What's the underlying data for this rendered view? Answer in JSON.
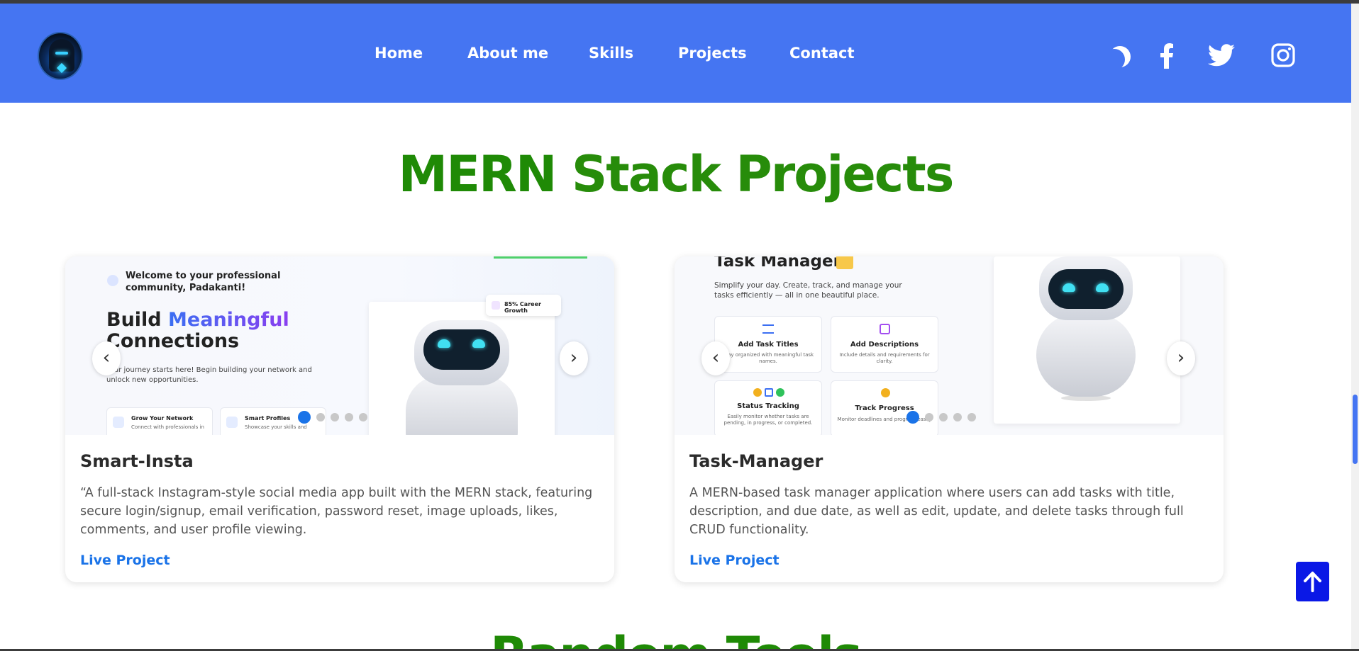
{
  "nav": {
    "links": [
      "Home",
      "About me",
      "Skills",
      "Projects",
      "Contact"
    ],
    "icons": [
      "moon-icon",
      "facebook-icon",
      "twitter-icon",
      "instagram-icon"
    ]
  },
  "section": {
    "title_word1": "MERN",
    "title_word2": "Stack Projects",
    "next_title": "Random Tools"
  },
  "projects": [
    {
      "title": "Smart-Insta",
      "description": "“A full-stack Instagram-style social media app built with the MERN stack, featuring secure login/signup, email verification, password reset, image uploads, likes, comments, and user profile viewing.",
      "link": "Live Project",
      "preview": {
        "welcome": "Welcome to your professional community, Padakanti!",
        "headline_1": "Build",
        "headline_2": "Meaningful",
        "headline_3": "Connections",
        "subtext": "Your journey starts here! Begin building your network and unlock new opportunities.",
        "badge": "85% Career Growth",
        "feature_1": "Grow Your Network",
        "feature_1_desc": "Connect with professionals in",
        "feature_2": "Smart Profiles",
        "feature_2_desc": "Showcase your skills and"
      },
      "slides": 5,
      "active_slide": 1
    },
    {
      "title": "Task-Manager",
      "description": "A MERN-based task manager application where users can add tasks with title, description, and due date, as well as edit, update, and delete tasks through full CRUD functionality.",
      "link": "Live Project",
      "preview": {
        "heading": "Task Manager",
        "subtext": "Simplify your day. Create, track, and manage your tasks efficiently — all in one beautiful place.",
        "feature_1": "Add Task Titles",
        "feature_1_desc": "Stay organized with meaningful task names.",
        "feature_2": "Add Descriptions",
        "feature_2_desc": "Include details and requirements for clarity.",
        "feature_3": "Status Tracking",
        "feature_3_desc": "Easily monitor whether tasks are pending, in progress, or completed.",
        "feature_4": "Track Progress",
        "feature_4_desc": "Monitor deadlines and progress easily"
      },
      "slides": 5,
      "active_slide": 1
    }
  ],
  "colors": {
    "navbar": "#4575f2",
    "title_green": "#1f8a06",
    "link_blue": "#1a73e8",
    "back_to_top": "#0a18e6"
  }
}
